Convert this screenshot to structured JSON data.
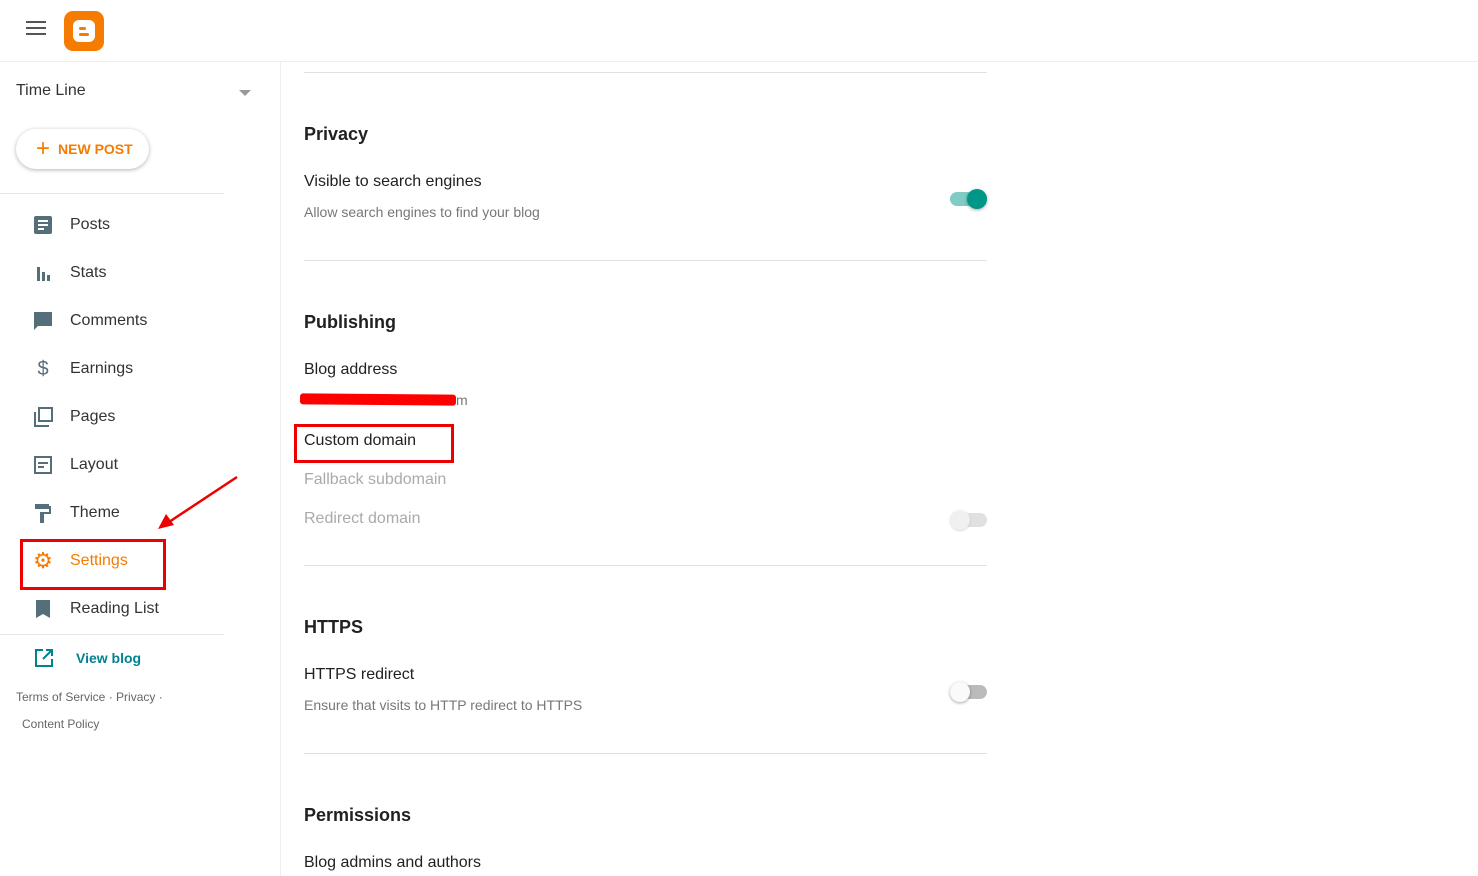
{
  "header": {
    "menu_icon": "hamburger-icon",
    "logo": "blogger-logo"
  },
  "sidebar": {
    "blog_name": "Time Line",
    "new_post": "NEW POST",
    "items": [
      {
        "label": "Posts",
        "icon": "posts-icon"
      },
      {
        "label": "Stats",
        "icon": "stats-icon"
      },
      {
        "label": "Comments",
        "icon": "comments-icon"
      },
      {
        "label": "Earnings",
        "icon": "dollar-icon"
      },
      {
        "label": "Pages",
        "icon": "pages-icon"
      },
      {
        "label": "Layout",
        "icon": "layout-icon"
      },
      {
        "label": "Theme",
        "icon": "paint-roller-icon"
      },
      {
        "label": "Settings",
        "icon": "gear-icon",
        "active": true
      },
      {
        "label": "Reading List",
        "icon": "bookmark-icon"
      }
    ],
    "view_blog": "View blog",
    "footer": {
      "terms": "Terms of Service",
      "privacy": "Privacy",
      "content_policy": "Content Policy",
      "sep": "·"
    }
  },
  "main": {
    "privacy": {
      "title": "Privacy",
      "visible_label": "Visible to search engines",
      "visible_desc": "Allow search engines to find your blog",
      "visible_on": true
    },
    "publishing": {
      "title": "Publishing",
      "blog_address_label": "Blog address",
      "blog_address_visible": "m",
      "custom_domain": "Custom domain",
      "fallback": "Fallback subdomain",
      "redirect": "Redirect domain",
      "redirect_on": false
    },
    "https": {
      "title": "HTTPS",
      "redirect_label": "HTTPS redirect",
      "redirect_desc": "Ensure that visits to HTTP redirect to HTTPS",
      "redirect_on": false
    },
    "permissions": {
      "title": "Permissions",
      "admins_label": "Blog admins and authors"
    }
  },
  "colors": {
    "accent": "#f57c00",
    "toggle_on": "#009688",
    "annotation": "#e00000",
    "link": "#00838f"
  }
}
